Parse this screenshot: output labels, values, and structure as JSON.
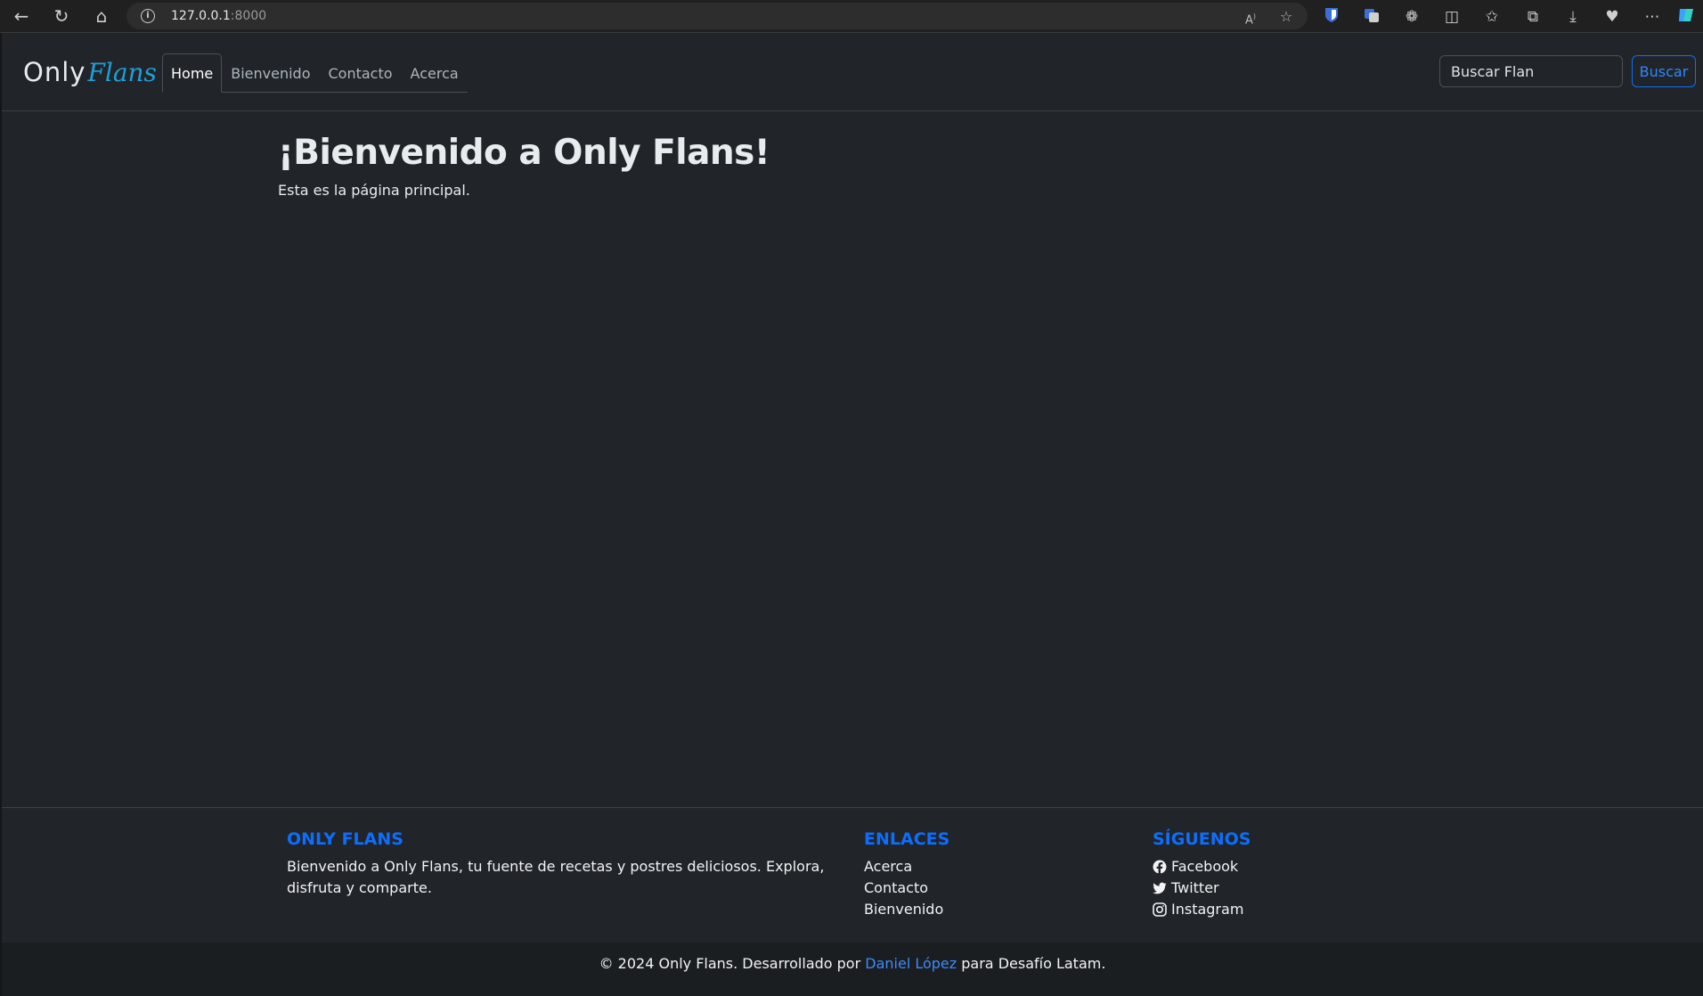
{
  "browser": {
    "url_host": "127.0.0.1",
    "url_port": ":8000",
    "icons": [
      "back-icon",
      "reload-icon",
      "home-icon",
      "info-icon",
      "read-aloud-icon",
      "favorite-star-icon",
      "bitwarden-icon",
      "translate-icon",
      "extensions-icon",
      "split-screen-icon",
      "favorites-icon",
      "collections-icon",
      "downloads-icon",
      "health-icon",
      "more-icon",
      "copilot-icon"
    ]
  },
  "navbar": {
    "brand_only": "Only",
    "brand_flans": "Flans",
    "links": [
      {
        "label": "Home",
        "active": true
      },
      {
        "label": "Bienvenido",
        "active": false
      },
      {
        "label": "Contacto",
        "active": false
      },
      {
        "label": "Acerca",
        "active": false
      }
    ],
    "search_placeholder": "Buscar Flan",
    "search_button": "Buscar"
  },
  "main": {
    "title": "¡Bienvenido a Only Flans!",
    "subtitle": "Esta es la página principal."
  },
  "footer": {
    "about": {
      "heading": "ONLY FLANS",
      "text": "Bienvenido a Only Flans, tu fuente de recetas y postres deliciosos. Explora, disfruta y comparte."
    },
    "links": {
      "heading": "ENLACES",
      "items": [
        "Acerca",
        "Contacto",
        "Bienvenido"
      ]
    },
    "social": {
      "heading": "SÍGUENOS",
      "items": [
        {
          "label": "Facebook",
          "icon": "facebook-icon"
        },
        {
          "label": "Twitter",
          "icon": "twitter-icon"
        },
        {
          "label": "Instagram",
          "icon": "instagram-icon"
        }
      ]
    },
    "copyright_prefix": "© 2024 Only Flans. Desarrollado por",
    "author": "Daniel López",
    "copyright_suffix": "para Desafío Latam."
  },
  "colors": {
    "page_bg": "#212529",
    "accent": "#0d6efd",
    "brand_flans": "#1ea0d9"
  }
}
